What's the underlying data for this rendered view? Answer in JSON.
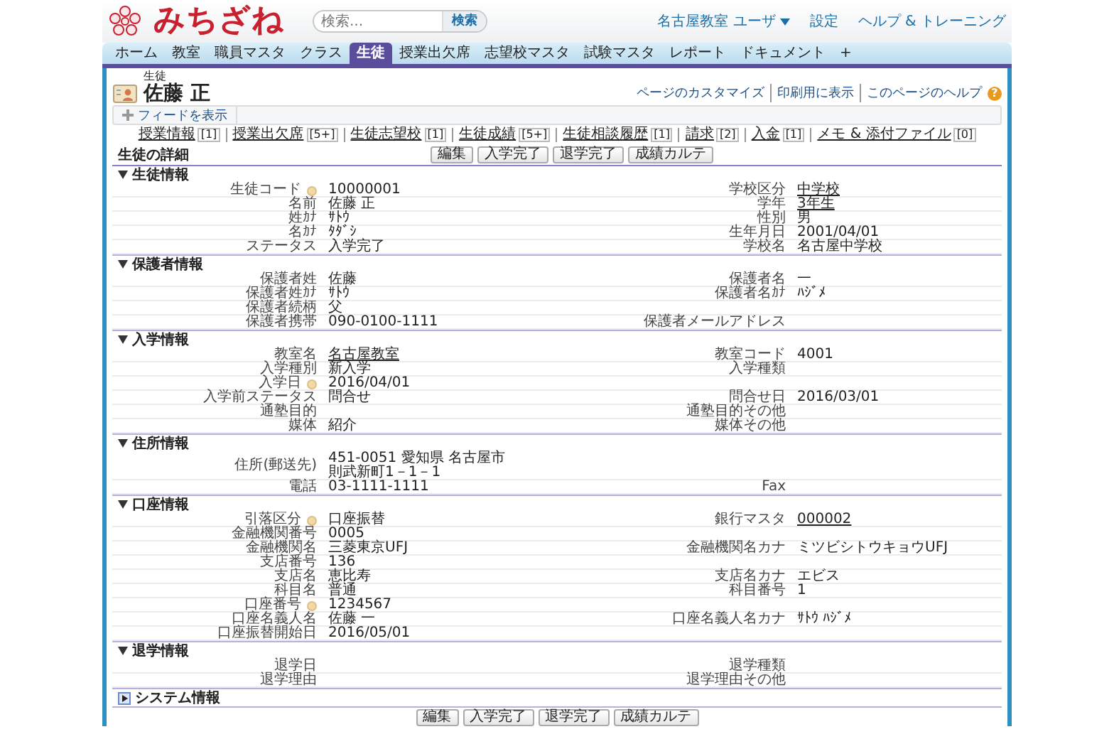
{
  "header": {
    "logo": "みちざね",
    "search": {
      "placeholder": "検索...",
      "button": "検索"
    },
    "user_menu": "名古屋教室 ユーザ",
    "links": [
      "設定",
      "ヘルプ & トレーニング"
    ]
  },
  "tabs": [
    {
      "label": "ホーム",
      "selected": false
    },
    {
      "label": "教室",
      "selected": false
    },
    {
      "label": "職員マスタ",
      "selected": false
    },
    {
      "label": "クラス",
      "selected": false
    },
    {
      "label": "生徒",
      "selected": true
    },
    {
      "label": "授業出欠席",
      "selected": false
    },
    {
      "label": "志望校マスタ",
      "selected": false
    },
    {
      "label": "試験マスタ",
      "selected": false
    },
    {
      "label": "レポート",
      "selected": false
    },
    {
      "label": "ドキュメント",
      "selected": false
    },
    {
      "label": "+",
      "selected": false
    }
  ],
  "record": {
    "type_label": "生徒",
    "name": "佐藤 正",
    "links": [
      "ページのカスタマイズ",
      "印刷用に表示",
      "このページのヘルプ"
    ],
    "help_icon": "?"
  },
  "feed_button": "フィードを表示",
  "related_lists": [
    {
      "label": "授業情報",
      "count": "[1]"
    },
    {
      "label": "授業出欠席",
      "count": "[5+]"
    },
    {
      "label": "生徒志望校",
      "count": "[1]"
    },
    {
      "label": "生徒成績",
      "count": "[5+]"
    },
    {
      "label": "生徒相談履歴",
      "count": "[1]"
    },
    {
      "label": "請求",
      "count": "[2]"
    },
    {
      "label": "入金",
      "count": "[1]"
    },
    {
      "label": "メモ & 添付ファイル",
      "count": "[0]"
    }
  ],
  "detail": {
    "title": "生徒の詳細",
    "buttons": [
      "編集",
      "入学完了",
      "退学完了",
      "成績カルテ"
    ],
    "sections": [
      {
        "title": "生徒情報",
        "expanded": true,
        "rows": [
          {
            "left": {
              "label": "生徒コード",
              "value": "10000001",
              "kind": "hint"
            },
            "right": {
              "label": "学校区分",
              "value": "中学校",
              "kind": "link"
            }
          },
          {
            "left": {
              "label": "名前",
              "value": "佐藤 正",
              "kind": "text"
            },
            "right": {
              "label": "学年",
              "value": "3年生",
              "kind": "link"
            }
          },
          {
            "left": {
              "label": "姓ｶﾅ",
              "value": "ｻﾄｳ",
              "kind": "text"
            },
            "right": {
              "label": "性別",
              "value": "男",
              "kind": "text"
            }
          },
          {
            "left": {
              "label": "名ｶﾅ",
              "value": "ﾀﾀﾞｼ",
              "kind": "text"
            },
            "right": {
              "label": "生年月日",
              "value": "2001/04/01",
              "kind": "text"
            }
          },
          {
            "left": {
              "label": "ステータス",
              "value": "入学完了",
              "kind": "text"
            },
            "right": {
              "label": "学校名",
              "value": "名古屋中学校",
              "kind": "text"
            }
          }
        ]
      },
      {
        "title": "保護者情報",
        "expanded": true,
        "rows": [
          {
            "left": {
              "label": "保護者姓",
              "value": "佐藤",
              "kind": "text"
            },
            "right": {
              "label": "保護者名",
              "value": "一",
              "kind": "text"
            }
          },
          {
            "left": {
              "label": "保護者姓ｶﾅ",
              "value": "ｻﾄｳ",
              "kind": "text"
            },
            "right": {
              "label": "保護者名ｶﾅ",
              "value": "ﾊｼﾞﾒ",
              "kind": "text"
            }
          },
          {
            "left": {
              "label": "保護者続柄",
              "value": "父",
              "kind": "text"
            }
          },
          {
            "left": {
              "label": "保護者携帯",
              "value": "090-0100-1111",
              "kind": "text"
            },
            "right": {
              "label": "保護者メールアドレス",
              "kind": "text"
            }
          }
        ]
      },
      {
        "title": "入学情報",
        "expanded": true,
        "rows": [
          {
            "left": {
              "label": "教室名",
              "value": "名古屋教室",
              "kind": "link"
            },
            "right": {
              "label": "教室コード",
              "value": "4001",
              "kind": "text"
            }
          },
          {
            "left": {
              "label": "入学種別",
              "value": "新入学",
              "kind": "text"
            },
            "right": {
              "label": "入学種類",
              "kind": "text"
            }
          },
          {
            "left": {
              "label": "入学日",
              "value": "2016/04/01",
              "kind": "hint"
            }
          },
          {
            "left": {
              "label": "入学前ステータス",
              "value": "問合せ",
              "kind": "text"
            },
            "right": {
              "label": "問合せ日",
              "value": "2016/03/01",
              "kind": "text"
            }
          },
          {
            "left": {
              "label": "通塾目的",
              "kind": "text"
            },
            "right": {
              "label": "通塾目的その他",
              "kind": "text"
            }
          },
          {
            "left": {
              "label": "媒体",
              "value": "紹介",
              "kind": "text"
            },
            "right": {
              "label": "媒体その他",
              "kind": "text"
            }
          }
        ]
      },
      {
        "title": "住所情報",
        "expanded": true,
        "rows": [
          {
            "left": {
              "label": "住所(郵送先)",
              "lines": [
                "451-0051 愛知県 名古屋市",
                "則武新町1－1－1"
              ],
              "kind": "text"
            }
          },
          {
            "left": {
              "label": "電話",
              "value": "03-1111-1111",
              "kind": "text"
            },
            "right": {
              "label": "Fax",
              "kind": "text"
            }
          }
        ]
      },
      {
        "title": "口座情報",
        "expanded": true,
        "rows": [
          {
            "left": {
              "label": "引落区分",
              "value": "口座振替",
              "kind": "hint"
            },
            "right": {
              "label": "銀行マスタ",
              "value": "000002",
              "kind": "link"
            }
          },
          {
            "left": {
              "label": "金融機関番号",
              "value": "0005",
              "kind": "text"
            }
          },
          {
            "left": {
              "label": "金融機関名",
              "value": "三菱東京UFJ",
              "kind": "text"
            },
            "right": {
              "label": "金融機関名カナ",
              "value": "ミツビシトウキョウUFJ",
              "kind": "text"
            }
          },
          {
            "left": {
              "label": "支店番号",
              "value": "136",
              "kind": "text"
            }
          },
          {
            "left": {
              "label": "支店名",
              "value": "恵比寿",
              "kind": "text"
            },
            "right": {
              "label": "支店名カナ",
              "value": "エビス",
              "kind": "text"
            }
          },
          {
            "left": {
              "label": "科目名",
              "value": "普通",
              "kind": "text"
            },
            "right": {
              "label": "科目番号",
              "value": "1",
              "kind": "text"
            }
          },
          {
            "left": {
              "label": "口座番号",
              "value": "1234567",
              "kind": "hint"
            }
          },
          {
            "left": {
              "label": "口座名義人名",
              "value": "佐藤 一",
              "kind": "text"
            },
            "right": {
              "label": "口座名義人名カナ",
              "value": "ｻﾄｳ ﾊｼﾞﾒ",
              "kind": "text"
            }
          },
          {
            "left": {
              "label": "口座振替開始日",
              "value": "2016/05/01",
              "kind": "text"
            }
          }
        ]
      },
      {
        "title": "退学情報",
        "expanded": true,
        "rows": [
          {
            "left": {
              "label": "退学日",
              "kind": "text"
            },
            "right": {
              "label": "退学種類",
              "kind": "text"
            }
          },
          {
            "left": {
              "label": "退学理由",
              "kind": "text"
            },
            "right": {
              "label": "退学理由その他",
              "kind": "text"
            }
          }
        ]
      },
      {
        "title": "システム情報",
        "expanded": false
      }
    ],
    "bottom_buttons": [
      "編集",
      "入学完了",
      "退学完了",
      "成績カルテ"
    ]
  }
}
